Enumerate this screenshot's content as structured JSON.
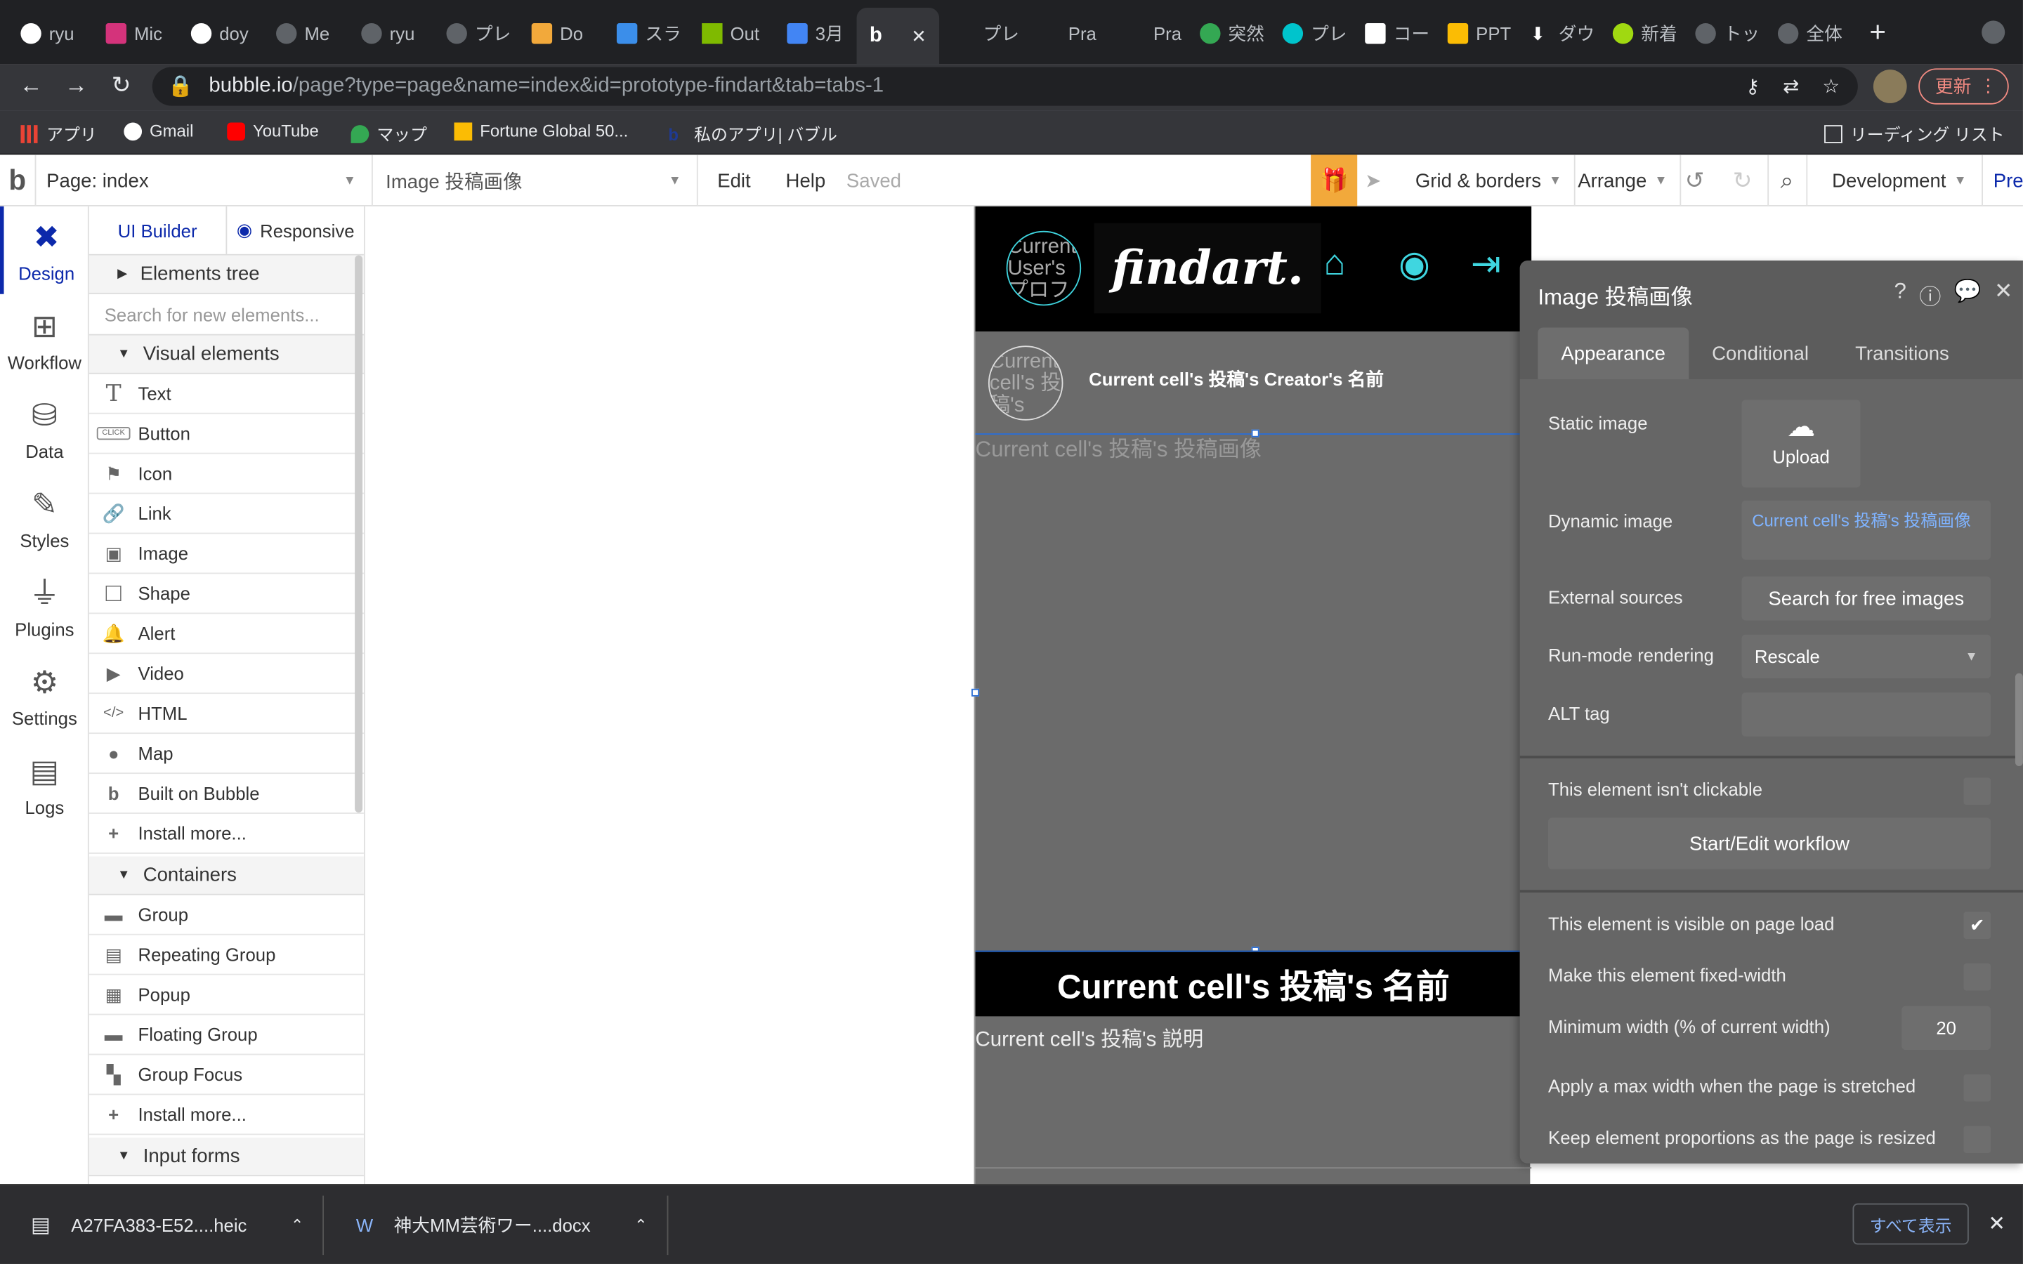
{
  "browser": {
    "tabs": [
      {
        "label": "ryu"
      },
      {
        "label": "Mic"
      },
      {
        "label": "doy"
      },
      {
        "label": "Me"
      },
      {
        "label": "ryu"
      },
      {
        "label": "プレ"
      },
      {
        "label": "Do"
      },
      {
        "label": "スラ"
      },
      {
        "label": "Out"
      },
      {
        "label": "3月"
      },
      {
        "label": ""
      },
      {
        "label": "プレ"
      },
      {
        "label": "Pra"
      },
      {
        "label": "Pra"
      },
      {
        "label": "突然"
      },
      {
        "label": "プレ"
      },
      {
        "label": "コー"
      },
      {
        "label": "PPT"
      },
      {
        "label": "ダウ"
      },
      {
        "label": "新着"
      },
      {
        "label": "トッ"
      },
      {
        "label": "全体"
      }
    ],
    "new_tab": "+",
    "url_host": "bubble.io",
    "url_path": "/page?type=page&name=index&id=prototype-findart&tab=tabs-1",
    "update_label": "更新",
    "bookmarks": [
      {
        "label": "アプリ"
      },
      {
        "label": "Gmail"
      },
      {
        "label": "YouTube"
      },
      {
        "label": "マップ"
      },
      {
        "label": "Fortune Global 50..."
      },
      {
        "label": "私のアプリ| バブル"
      }
    ],
    "reading_list": "リーディング リスト"
  },
  "bubble_bar": {
    "page_label": "Page: index",
    "element_label": "Image 投稿画像",
    "edit": "Edit",
    "help": "Help",
    "saved": "Saved",
    "grid_borders": "Grid & borders",
    "arrange": "Arrange",
    "development": "Development",
    "preview": "Pre"
  },
  "rail": [
    {
      "label": "Design"
    },
    {
      "label": "Workflow"
    },
    {
      "label": "Data"
    },
    {
      "label": "Styles"
    },
    {
      "label": "Plugins"
    },
    {
      "label": "Settings"
    },
    {
      "label": "Logs"
    }
  ],
  "palette": {
    "tab_ui_builder": "UI Builder",
    "tab_responsive": "Responsive",
    "elements_tree": "Elements tree",
    "search_placeholder": "Search for new elements...",
    "visual_elements": "Visual elements",
    "visual_items": [
      {
        "label": "Text",
        "icon": "T"
      },
      {
        "label": "Button",
        "icon": "CLICK"
      },
      {
        "label": "Icon",
        "icon": "⚑"
      },
      {
        "label": "Link",
        "icon": "🔗"
      },
      {
        "label": "Image",
        "icon": "▣"
      },
      {
        "label": "Shape",
        "icon": "□"
      },
      {
        "label": "Alert",
        "icon": "🔔"
      },
      {
        "label": "Video",
        "icon": "▶"
      },
      {
        "label": "HTML",
        "icon": "</>"
      },
      {
        "label": "Map",
        "icon": "●"
      },
      {
        "label": "Built on Bubble",
        "icon": "b"
      },
      {
        "label": "Install more...",
        "icon": "+"
      }
    ],
    "containers": "Containers",
    "container_items": [
      {
        "label": "Group",
        "icon": "▬"
      },
      {
        "label": "Repeating Group",
        "icon": "▤"
      },
      {
        "label": "Popup",
        "icon": "▦"
      },
      {
        "label": "Floating Group",
        "icon": "▬"
      },
      {
        "label": "Group Focus",
        "icon": "▚"
      },
      {
        "label": "Install more...",
        "icon": "+"
      }
    ],
    "input_forms": "Input forms"
  },
  "canvas": {
    "logo": "findart.",
    "user_circle_text": "Current User's プロフィール画像",
    "creator_circle_text": "Current cell's 投稿's",
    "creator_name": "Current cell's 投稿's Creator's 名前",
    "image_placeholder": "Current cell's 投稿's 投稿画像",
    "post_name": "Current cell's 投稿's 名前",
    "post_description": "Current cell's 投稿's 説明"
  },
  "props": {
    "title": "Image 投稿画像",
    "tabs": [
      {
        "label": "Appearance"
      },
      {
        "label": "Conditional"
      },
      {
        "label": "Transitions"
      }
    ],
    "static_image": "Static image",
    "upload": "Upload",
    "dynamic_image": "Dynamic image",
    "dynamic_value": "Current cell's 投稿's 投稿画像",
    "external_sources": "External sources",
    "search_free": "Search for free images",
    "run_mode": "Run-mode rendering",
    "run_mode_value": "Rescale",
    "alt_tag": "ALT tag",
    "alt_value": "",
    "not_clickable": "This element isn't clickable",
    "start_workflow": "Start/Edit workflow",
    "visible_on_load": "This element is visible on page load",
    "visible_checked": "✔",
    "fixed_width": "Make this element fixed-width",
    "min_width": "Minimum width (% of current width)",
    "min_width_value": "20",
    "max_width": "Apply a max width when the page is stretched",
    "keep_proportions": "Keep element proportions as the page is resized"
  },
  "downloads": {
    "items": [
      {
        "label": "A27FA383-E52....heic"
      },
      {
        "label": "神大MM芸術ワー....docx"
      }
    ],
    "show_all": "すべて表示",
    "close": "✕"
  }
}
